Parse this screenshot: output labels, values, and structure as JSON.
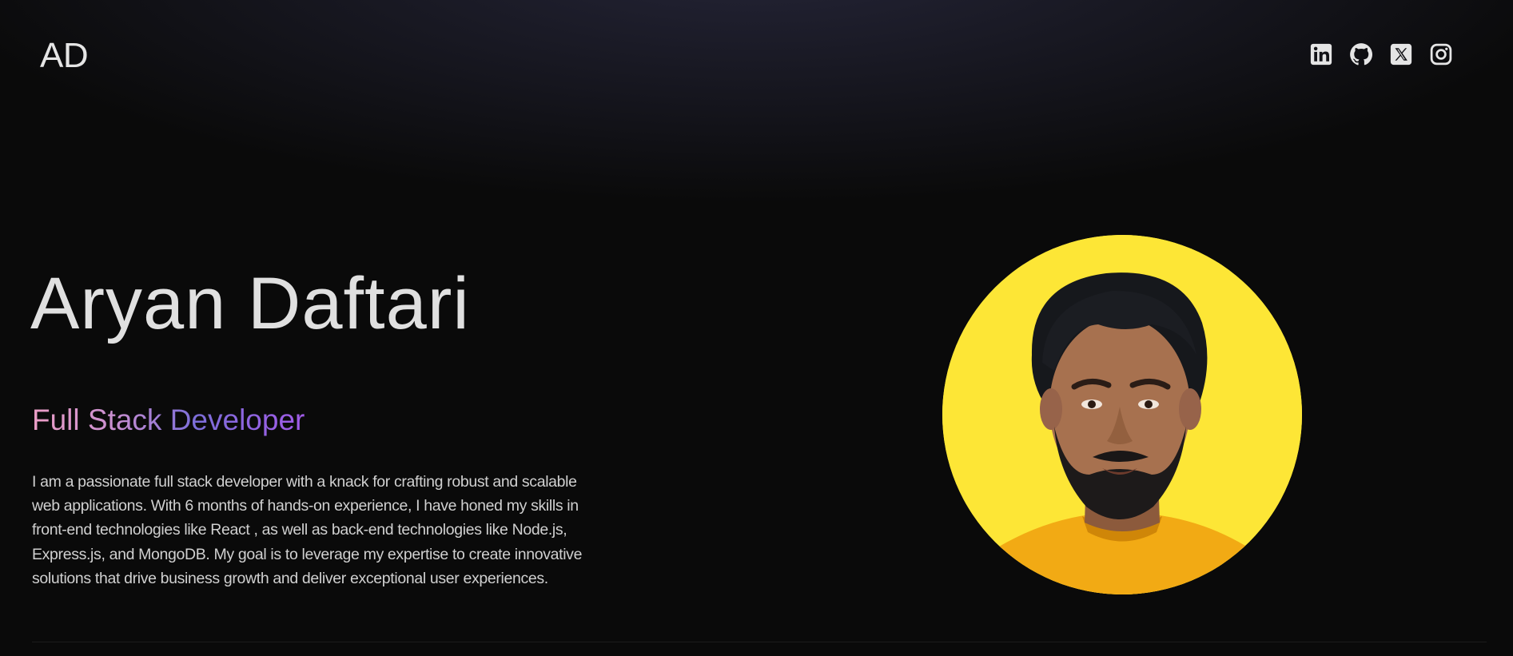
{
  "nav": {
    "logo": "AD",
    "socials": [
      {
        "name": "LinkedIn",
        "icon": "linkedin-icon"
      },
      {
        "name": "GitHub",
        "icon": "github-icon"
      },
      {
        "name": "X",
        "icon": "x-icon"
      },
      {
        "name": "Instagram",
        "icon": "instagram-icon"
      }
    ]
  },
  "hero": {
    "name": "Aryan Daftari",
    "role": "Full Stack Developer",
    "bio": "I am a passionate full stack developer with a knack for crafting robust and scalable web applications. With 6 months of hands-on experience, I have honed my skills in front-end technologies like React , as well as back-end technologies like Node.js, Express.js, and MongoDB. My goal is to leverage my expertise to create innovative solutions that drive business growth and deliver exceptional user experiences."
  },
  "colors": {
    "background": "#0a0a0a",
    "icon": "#e5e5e5",
    "avatar_background": "#fde636",
    "role_gradient": [
      "#ec9ec6",
      "#7c6ed8",
      "#a15be8"
    ]
  }
}
